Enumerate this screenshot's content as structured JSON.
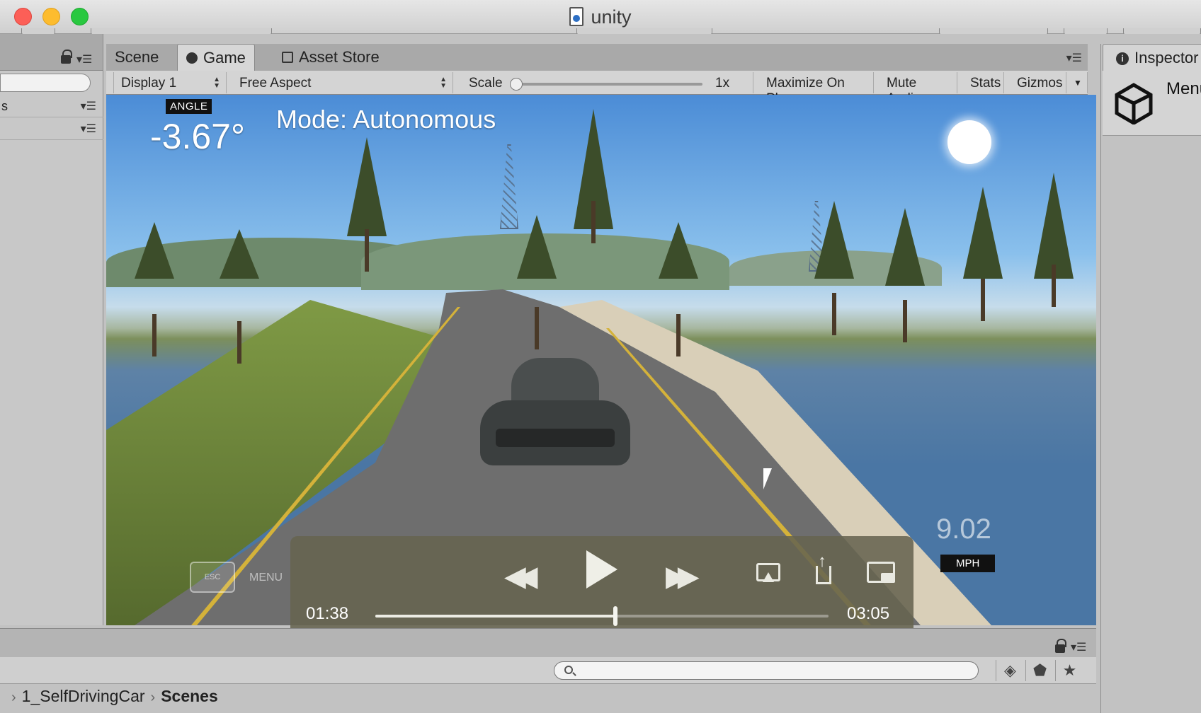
{
  "window": {
    "title": "unity"
  },
  "hierarchy": {
    "rows": [
      {
        "label": "s"
      },
      {
        "label": ""
      }
    ]
  },
  "game_view": {
    "tabs": [
      {
        "label": "Scene",
        "active": false
      },
      {
        "label": "Game",
        "active": true
      },
      {
        "label": "Asset Store",
        "active": false
      }
    ],
    "toolbar": {
      "display": "Display 1",
      "aspect": "Free Aspect",
      "scale_label": "Scale",
      "scale_value": "1x",
      "scale_level": 0,
      "maximize": "Maximize On Play",
      "mute": "Mute Audio",
      "stats": "Stats",
      "gizmos": "Gizmos"
    },
    "hud": {
      "angle_tag": "ANGLE",
      "angle_value": "-3.67°",
      "mode": "Mode: Autonomous",
      "speed_value": "9.02",
      "speed_unit": "MPH",
      "esc_label": "ESC",
      "menu_label": "MENU"
    }
  },
  "video_player": {
    "current_time": "01:38",
    "total_time": "03:05",
    "progress": 0.53,
    "controls": [
      "rewind-icon",
      "play-icon",
      "fast-forward-icon",
      "airplay-icon",
      "share-icon",
      "picture-in-picture-icon"
    ]
  },
  "inspector": {
    "tab": "Inspector",
    "object_name": "Menu"
  },
  "project": {
    "breadcrumb": [
      {
        "label": "1_SelfDrivingCar"
      },
      {
        "label": "Scenes"
      }
    ],
    "buttons": [
      "filter-by-type-icon",
      "filter-by-label-icon",
      "favorite-icon"
    ]
  },
  "colors": {
    "accent": "#d7d7d7",
    "video_overlay": "#67644f",
    "hud_tag": "#111111"
  }
}
